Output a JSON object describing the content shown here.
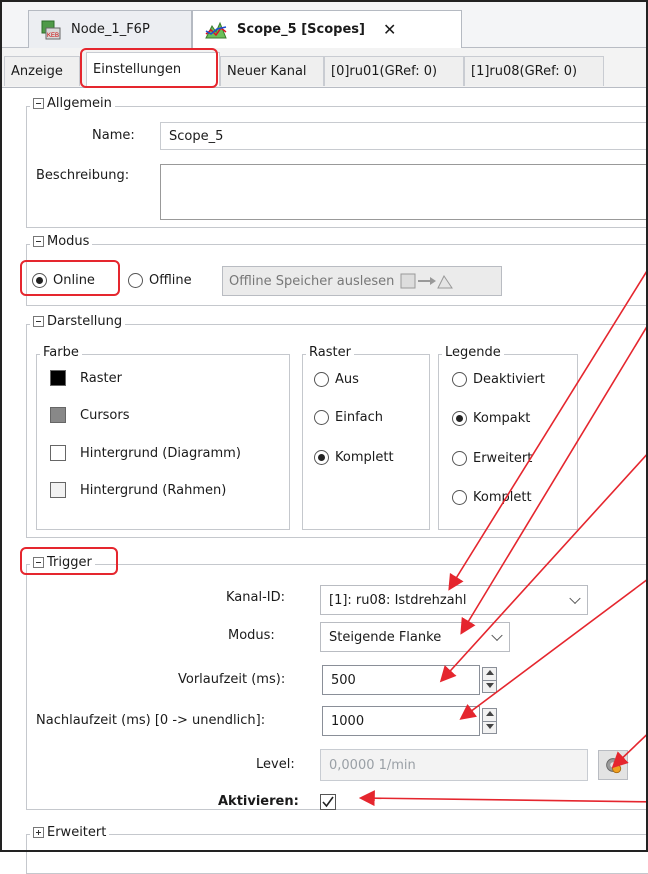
{
  "tabs": {
    "node": "Node_1_F6P",
    "scope": "Scope_5 [Scopes]",
    "close": "✕"
  },
  "subtabs": [
    "Anzeige",
    "Einstellungen",
    "Neuer Kanal",
    "[0]ru01(GRef: 0)",
    "[1]ru08(GRef: 0)"
  ],
  "allgemein": {
    "title": "Allgemein",
    "name_label": "Name:",
    "name_value": "Scope_5",
    "beschreibung_label": "Beschreibung:",
    "beschreibung_value": ""
  },
  "modus": {
    "title": "Modus",
    "online": "Online",
    "offline": "Offline",
    "read_button": "Offline Speicher auslesen"
  },
  "darstellung": {
    "title": "Darstellung",
    "farbe": {
      "title": "Farbe",
      "items": [
        "Raster",
        "Cursors",
        "Hintergrund (Diagramm)",
        "Hintergrund (Rahmen)"
      ],
      "colors": [
        "#000000",
        "#808080",
        "#ffffff",
        "#f2f2f2"
      ]
    },
    "raster": {
      "title": "Raster",
      "options": [
        "Aus",
        "Einfach",
        "Komplett"
      ],
      "selected": "Komplett"
    },
    "legende": {
      "title": "Legende",
      "options": [
        "Deaktiviert",
        "Kompakt",
        "Erweitert",
        "Komplett"
      ],
      "selected": "Kompakt"
    }
  },
  "trigger": {
    "title": "Trigger",
    "kanal_label": "Kanal-ID:",
    "kanal_value": "[1]: ru08: Istdrehzahl",
    "modus_label": "Modus:",
    "modus_value": "Steigende Flanke",
    "vorlauf_label": "Vorlaufzeit (ms):",
    "vorlauf_value": "500",
    "nachlauf_label": "Nachlaufzeit (ms) [0 -> unendlich]:",
    "nachlauf_value": "1000",
    "level_label": "Level:",
    "level_value": "0,0000 1/min",
    "aktivieren_label": "Aktivieren:",
    "aktivieren_checked": true
  },
  "erweitert": {
    "title": "Erweitert"
  },
  "colors": {
    "callout": "#e5262e",
    "selected_tab": "#ffffff"
  }
}
